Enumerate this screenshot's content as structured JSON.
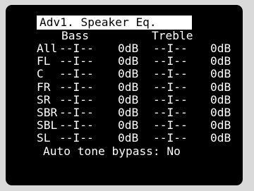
{
  "screen": {
    "title": "Adv1. Speaker Eq.",
    "headers": {
      "bass": "Bass",
      "treble": "Treble"
    },
    "rows": [
      {
        "channel": "All",
        "bass_slider": "--I--",
        "bass_value": "0dB",
        "treble_slider": "--I--",
        "treble_value": "0dB"
      },
      {
        "channel": "FL ",
        "bass_slider": "--I--",
        "bass_value": "0dB",
        "treble_slider": "--I--",
        "treble_value": "0dB"
      },
      {
        "channel": "C  ",
        "bass_slider": "--I--",
        "bass_value": "0dB",
        "treble_slider": "--I--",
        "treble_value": "0dB"
      },
      {
        "channel": "FR ",
        "bass_slider": "--I--",
        "bass_value": "0dB",
        "treble_slider": "--I--",
        "treble_value": "0dB"
      },
      {
        "channel": "SR ",
        "bass_slider": "--I--",
        "bass_value": "0dB",
        "treble_slider": "--I--",
        "treble_value": "0dB"
      },
      {
        "channel": "SBR",
        "bass_slider": "--I--",
        "bass_value": "0dB",
        "treble_slider": "--I--",
        "treble_value": "0dB"
      },
      {
        "channel": "SBL",
        "bass_slider": "--I--",
        "bass_value": "0dB",
        "treble_slider": "--I--",
        "treble_value": "0dB"
      },
      {
        "channel": "SL ",
        "bass_slider": "--I--",
        "bass_value": "0dB",
        "treble_slider": "--I--",
        "treble_value": "0dB"
      }
    ],
    "auto_tone_bypass": "Auto tone bypass: No"
  },
  "colors": {
    "screen_background": "#000000",
    "text": "#ffffff",
    "highlight_background": "#ffffff",
    "highlight_text": "#000000",
    "bezel": "#d9d9d9"
  }
}
